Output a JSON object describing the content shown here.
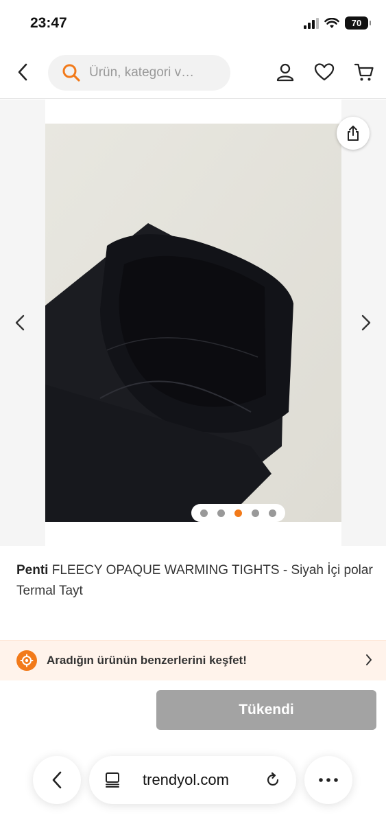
{
  "status_bar": {
    "time": "23:47",
    "battery": "70"
  },
  "header": {
    "search_placeholder": "Ürün, kategori v…",
    "icons": [
      "back-icon",
      "search-icon",
      "user-icon",
      "heart-icon",
      "cart-icon"
    ]
  },
  "gallery": {
    "image_description": "black fleece tights",
    "dots_total": 5,
    "active_dot": 3
  },
  "product": {
    "brand": "Penti",
    "name": " FLEECY OPAQUE WARMING TIGHTS - Siyah İçi polar Termal Tayt"
  },
  "discover": {
    "text": "Aradığın ürünün benzerlerini keşfet!"
  },
  "action": {
    "label": "Tükendi"
  },
  "browser": {
    "url": "trendyol.com"
  },
  "colors": {
    "accent": "#f27a1a",
    "soldout": "#a3a3a3",
    "discover_bg": "#fff3eb"
  }
}
